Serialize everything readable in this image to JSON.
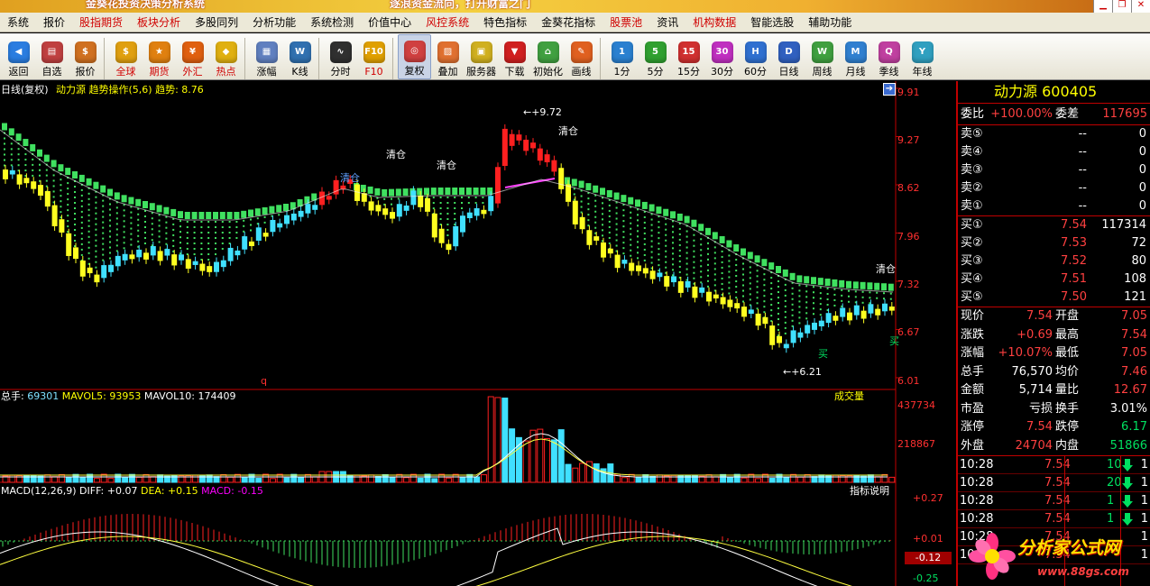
{
  "title": "金葵花投资决策分析系统",
  "slogan": "逐浪资金流向，打开财富之门",
  "menu": [
    {
      "label": "系统",
      "red": false
    },
    {
      "label": "报价",
      "red": false
    },
    {
      "label": "股指期货",
      "red": true
    },
    {
      "label": "板块分析",
      "red": true
    },
    {
      "label": "多股同列",
      "red": false
    },
    {
      "label": "分析功能",
      "red": false
    },
    {
      "label": "系统检测",
      "red": false
    },
    {
      "label": "价值中心",
      "red": false
    },
    {
      "label": "风控系统",
      "red": true
    },
    {
      "label": "特色指标",
      "red": false
    },
    {
      "label": "金葵花指标",
      "red": false
    },
    {
      "label": "股票池",
      "red": true
    },
    {
      "label": "资讯",
      "red": false
    },
    {
      "label": "机构数据",
      "red": true
    },
    {
      "label": "智能选股",
      "red": false
    },
    {
      "label": "辅助功能",
      "red": false
    }
  ],
  "toolbar": [
    {
      "label": "返回",
      "icon": "back-icon",
      "glyph": "◀",
      "color": "#2a7de0",
      "red": false
    },
    {
      "label": "自选",
      "icon": "basket-icon",
      "glyph": "▤",
      "color": "#c04040",
      "red": false
    },
    {
      "label": "报价",
      "icon": "price-icon",
      "glyph": "$",
      "color": "#d07020",
      "red": false
    },
    {
      "sep": true
    },
    {
      "label": "全球",
      "icon": "globe-icon",
      "glyph": "$",
      "color": "#e0a010",
      "red": true
    },
    {
      "label": "期货",
      "icon": "futures-icon",
      "glyph": "★",
      "color": "#e08010",
      "red": true
    },
    {
      "label": "外汇",
      "icon": "forex-icon",
      "glyph": "¥",
      "color": "#e06010",
      "red": true
    },
    {
      "label": "热点",
      "icon": "hot-icon",
      "glyph": "◆",
      "color": "#e0b010",
      "red": true
    },
    {
      "sep": true
    },
    {
      "label": "涨幅",
      "icon": "gain-icon",
      "glyph": "▦",
      "color": "#6080c0",
      "red": false
    },
    {
      "label": "K线",
      "icon": "kline-icon",
      "glyph": "W",
      "color": "#3070b0",
      "red": false
    },
    {
      "sep": true
    },
    {
      "label": "分时",
      "icon": "intraday-icon",
      "glyph": "∿",
      "color": "#303030",
      "red": false
    },
    {
      "label": "F10",
      "icon": "f10-icon",
      "glyph": "F10",
      "color": "#e0a000",
      "red": true
    },
    {
      "sep": true
    },
    {
      "label": "复权",
      "icon": "restore-icon",
      "glyph": "◎",
      "color": "#d04040",
      "red": false,
      "active": true
    },
    {
      "label": "叠加",
      "icon": "overlay-icon",
      "glyph": "▨",
      "color": "#e07030",
      "red": false
    },
    {
      "label": "服务器",
      "icon": "server-icon",
      "glyph": "▣",
      "color": "#d0b020",
      "red": false
    },
    {
      "label": "下载",
      "icon": "download-icon",
      "glyph": "▼",
      "color": "#d02020",
      "red": false
    },
    {
      "label": "初始化",
      "icon": "home-icon",
      "glyph": "⌂",
      "color": "#40a040",
      "red": false
    },
    {
      "label": "画线",
      "icon": "draw-icon",
      "glyph": "✎",
      "color": "#e06020",
      "red": false
    },
    {
      "sep": true
    },
    {
      "label": "1分",
      "icon": "1min-icon",
      "glyph": "1",
      "color": "#2a80d0",
      "red": false
    },
    {
      "label": "5分",
      "icon": "5min-icon",
      "glyph": "5",
      "color": "#30a030",
      "red": false
    },
    {
      "label": "15分",
      "icon": "15min-icon",
      "glyph": "15",
      "color": "#d03030",
      "red": false
    },
    {
      "label": "30分",
      "icon": "30min-icon",
      "glyph": "30",
      "color": "#c030c0",
      "red": false
    },
    {
      "label": "60分",
      "icon": "60min-icon",
      "glyph": "H",
      "color": "#3070d0",
      "red": false
    },
    {
      "label": "日线",
      "icon": "daily-icon",
      "glyph": "D",
      "color": "#3060c0",
      "red": false
    },
    {
      "label": "周线",
      "icon": "weekly-icon",
      "glyph": "W",
      "color": "#40a040",
      "red": false
    },
    {
      "label": "月线",
      "icon": "monthly-icon",
      "glyph": "M",
      "color": "#3080d0",
      "red": false
    },
    {
      "label": "季线",
      "icon": "quarter-icon",
      "glyph": "Q",
      "color": "#c040a0",
      "red": false
    },
    {
      "label": "年线",
      "icon": "yearly-icon",
      "glyph": "Y",
      "color": "#30a0c0",
      "red": false
    }
  ],
  "chart": {
    "main_label": "日线(复权)",
    "formula_label": "动力源 趋势操作(5,6) 趋势:",
    "trend_value": "8.76",
    "price_axis": [
      "9.91",
      "9.27",
      "8.62",
      "7.96",
      "7.32",
      "6.67",
      "6.01"
    ],
    "annotations": {
      "high": "+9.72",
      "low": "+6.21",
      "clear1": "清仓",
      "clear2": "清仓",
      "clear3": "清仓",
      "clear4": "清仓",
      "clear5": "清仓",
      "buy1": "买",
      "buy2": "买",
      "q": "q"
    },
    "volume_label": "总手: ",
    "volume_value": "69301",
    "mavol5_label": "MAVOL5: ",
    "mavol5_value": "93953",
    "mavol10_label": "MAVOL10: ",
    "mavol10_value": "174409",
    "volume_title": "成交量",
    "volume_axis": [
      "437734",
      "218867"
    ],
    "macd_label": "MACD(12,26,9)",
    "diff_label": "DIFF: ",
    "diff_value": "+0.07",
    "dea_label": "DEA: ",
    "dea_value": "+0.15",
    "macd_value_label": "MACD: ",
    "macd_value": "-0.15",
    "indicator_help": "指标说明",
    "macd_axis": [
      "+0.27",
      "+0.01",
      "-0.12",
      "-0.25"
    ]
  },
  "quote": {
    "name": "动力源",
    "code": "600405",
    "weibi_label": "委比",
    "weibi": "+100.00%",
    "weicha_label": "委差",
    "weicha": "117695",
    "sells": [
      {
        "label": "卖⑤",
        "price": "--",
        "vol": "0"
      },
      {
        "label": "卖④",
        "price": "--",
        "vol": "0"
      },
      {
        "label": "卖③",
        "price": "--",
        "vol": "0"
      },
      {
        "label": "卖②",
        "price": "--",
        "vol": "0"
      },
      {
        "label": "卖①",
        "price": "--",
        "vol": "0"
      }
    ],
    "buys": [
      {
        "label": "买①",
        "price": "7.54",
        "vol": "117314"
      },
      {
        "label": "买②",
        "price": "7.53",
        "vol": "72"
      },
      {
        "label": "买③",
        "price": "7.52",
        "vol": "80"
      },
      {
        "label": "买④",
        "price": "7.51",
        "vol": "108"
      },
      {
        "label": "买⑤",
        "price": "7.50",
        "vol": "121"
      }
    ],
    "stats": [
      {
        "l1": "现价",
        "v1": "7.54",
        "c1": "#ff4040",
        "l2": "开盘",
        "v2": "7.05",
        "c2": "#ff4040"
      },
      {
        "l1": "涨跌",
        "v1": "+0.69",
        "c1": "#ff4040",
        "l2": "最高",
        "v2": "7.54",
        "c2": "#ff4040"
      },
      {
        "l1": "涨幅",
        "v1": "+10.07%",
        "c1": "#ff4040",
        "l2": "最低",
        "v2": "7.05",
        "c2": "#ff4040"
      },
      {
        "l1": "总手",
        "v1": "76,570",
        "c1": "#ffffff",
        "l2": "均价",
        "v2": "7.46",
        "c2": "#ff4040"
      },
      {
        "l1": "金额",
        "v1": "5,714",
        "c1": "#ffffff",
        "l2": "量比",
        "v2": "12.67",
        "c2": "#ff4040"
      },
      {
        "l1": "市盈",
        "v1": "亏损",
        "c1": "#ffffff",
        "l2": "换手",
        "v2": "3.01%",
        "c2": "#ffffff"
      },
      {
        "l1": "涨停",
        "v1": "7.54",
        "c1": "#ff4040",
        "l2": "跌停",
        "v2": "6.17",
        "c2": "#00e060"
      },
      {
        "l1": "外盘",
        "v1": "24704",
        "c1": "#ff4040",
        "l2": "内盘",
        "v2": "51866",
        "c2": "#00e060"
      }
    ],
    "ticks": [
      {
        "time": "10:28",
        "price": "7.54",
        "vol": "10",
        "n": "1"
      },
      {
        "time": "10:28",
        "price": "7.54",
        "vol": "20",
        "n": "1"
      },
      {
        "time": "10:28",
        "price": "7.54",
        "vol": "1",
        "n": "1"
      },
      {
        "time": "10:28",
        "price": "7.54",
        "vol": "1",
        "n": "1"
      },
      {
        "time": "10:28",
        "price": "7.54",
        "vol": "",
        "n": "1"
      },
      {
        "time": "10:28",
        "price": "7.54",
        "vol": "",
        "n": "1"
      }
    ]
  },
  "watermark": {
    "name": "分析家公式网",
    "url": "www.88gs.com"
  }
}
